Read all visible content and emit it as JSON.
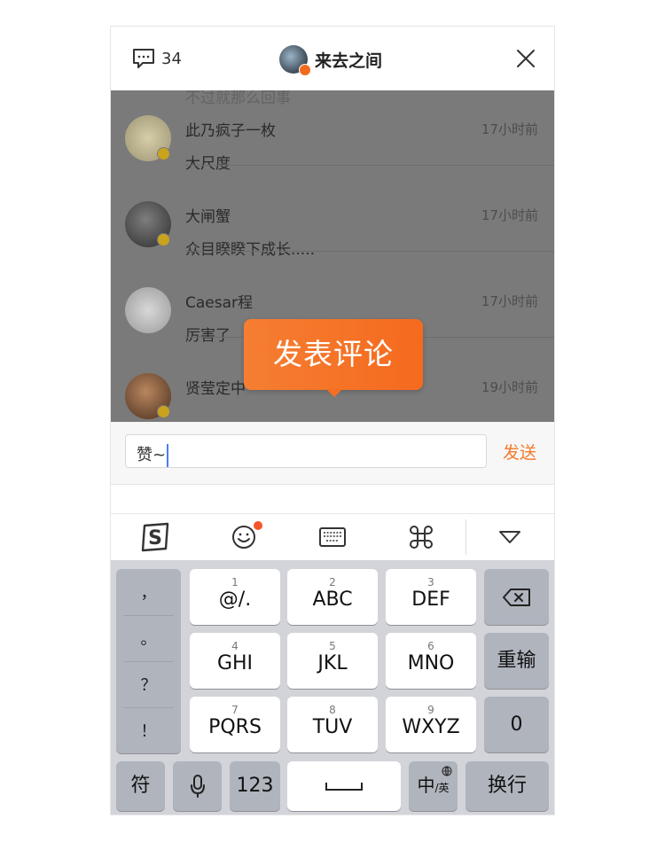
{
  "header": {
    "comment_count": "34",
    "user_name": "来去之间"
  },
  "list": {
    "partial_text": "不过就那么回事",
    "comments": [
      {
        "name": "此乃疯子一枚",
        "time": "17小时前",
        "text": "大尺度",
        "avatar_color": "#c8bd9a"
      },
      {
        "name": "大闸蟹",
        "time": "17小时前",
        "text": "众目睽睽下成长.....",
        "avatar_color": "#4d4d4d"
      },
      {
        "name": "Caesar程",
        "time": "17小时前",
        "text": "厉害了",
        "avatar_color": "#d4d4d4"
      },
      {
        "name": "贤莹定中",
        "time": "19小时前",
        "text": "",
        "avatar_color": "#8a5a3c"
      }
    ]
  },
  "tooltip": {
    "label": "发表评论"
  },
  "input": {
    "value": "赞~"
  },
  "send": {
    "label": "发送"
  },
  "toolbar": {
    "items": [
      "sogou-logo-icon",
      "emoji-icon",
      "keyboard-icon",
      "command-icon",
      "collapse-triangle-icon"
    ]
  },
  "keyboard": {
    "punctuation": [
      "，",
      "。",
      "？",
      "！"
    ],
    "keys": [
      {
        "num": "1",
        "label": "@/."
      },
      {
        "num": "2",
        "label": "ABC"
      },
      {
        "num": "3",
        "label": "DEF"
      },
      {
        "num": "4",
        "label": "GHI"
      },
      {
        "num": "5",
        "label": "JKL"
      },
      {
        "num": "6",
        "label": "MNO"
      },
      {
        "num": "7",
        "label": "PQRS"
      },
      {
        "num": "8",
        "label": "TUV"
      },
      {
        "num": "9",
        "label": "WXYZ"
      }
    ],
    "reenter": "重输",
    "zero": "0",
    "symbols": "符",
    "numbers": "123",
    "lang_main": "中",
    "lang_sub": "/英",
    "return": "换行"
  },
  "colors": {
    "accent": "#f57a2a",
    "caret": "#4a7cf3"
  }
}
